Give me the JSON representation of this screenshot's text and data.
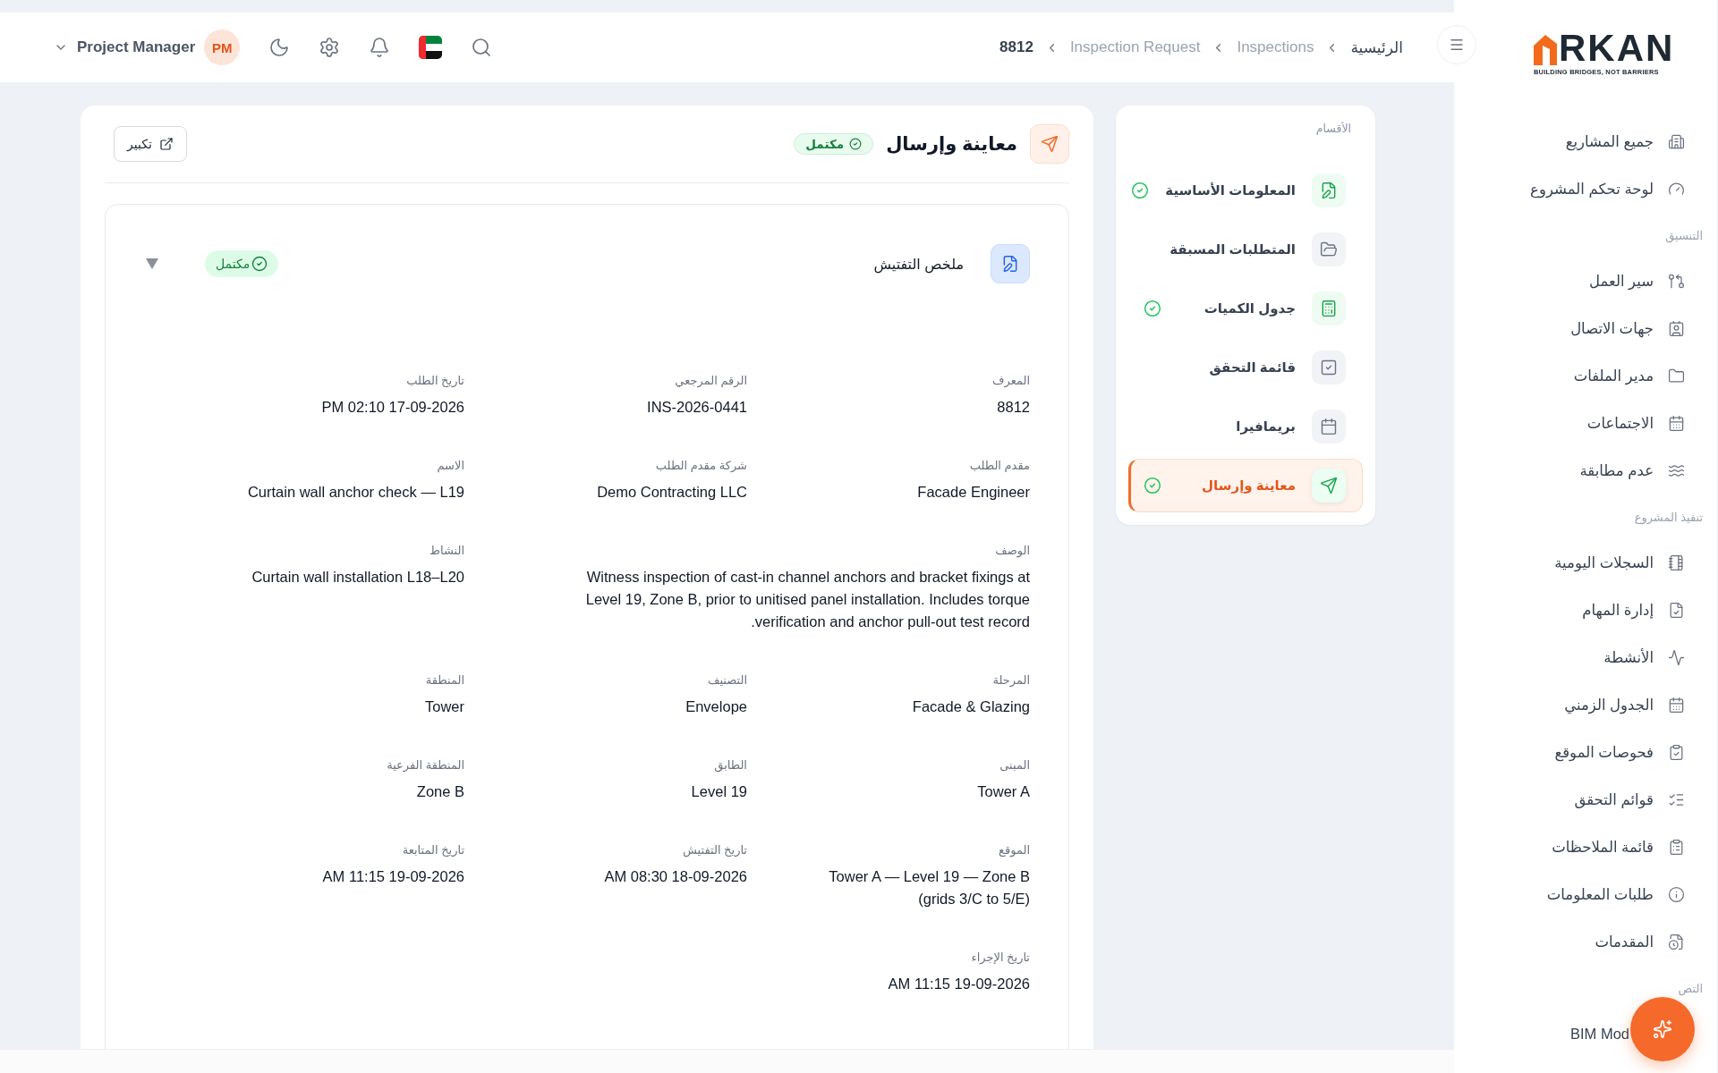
{
  "header": {
    "breadcrumb": [
      {
        "label": "الرئيسية",
        "kind": "home"
      },
      {
        "label": "Inspections",
        "kind": "link"
      },
      {
        "label": "Inspection Request",
        "kind": "link"
      },
      {
        "label": "8812",
        "kind": "current"
      }
    ],
    "user": {
      "name": "Project Manager",
      "initials": "PM"
    }
  },
  "sidebar": {
    "logo": {
      "wordmark": "RKAN",
      "tagline": "BUILDING BRIDGES, NOT BARRIERS"
    },
    "groups": [
      {
        "items": [
          "جميع المشاريع",
          "لوحة تحكم المشروع"
        ]
      },
      {
        "heading": "التنسيق",
        "items": [
          "سير العمل",
          "جهات الاتصال",
          "مدير الملفات",
          "الاجتماعات",
          "عدم مطابقة"
        ]
      },
      {
        "heading": "تنفيذ المشروع",
        "items": [
          "السجلات اليومية",
          "إدارة المهام",
          "الأنشطة",
          "الجدول الزمني",
          "فحوصات الموقع",
          "قوائم التحقق",
          "قائمة الملاحظات",
          "طلبات المعلومات",
          "المقدمات"
        ]
      },
      {
        "heading": "التص",
        "items": [
          "BIM Mod"
        ]
      }
    ]
  },
  "sections": {
    "title": "الأقسام",
    "items": [
      {
        "label": "المعلومات الأساسية",
        "completed": true,
        "selected": false
      },
      {
        "label": "المتطلبات المسبقة",
        "completed": false,
        "selected": false
      },
      {
        "label": "جدول الكميات",
        "completed": true,
        "selected": false
      },
      {
        "label": "قائمة التحقق",
        "completed": false,
        "selected": false
      },
      {
        "label": "بريمافيرا",
        "completed": false,
        "selected": false
      },
      {
        "label": "معاينة وإرسال",
        "completed": true,
        "selected": true
      }
    ]
  },
  "panel": {
    "title": "معاينة وإرسال",
    "status": "مكتمل",
    "expand_label": "تكبير",
    "summary": {
      "title": "ملخص التفتيش",
      "status": "مكتمل",
      "fields": [
        {
          "label": "المعرف",
          "value": "8812",
          "kind": "short"
        },
        {
          "label": "الرقم المرجعي",
          "value": "INS-2026-0441",
          "kind": "short"
        },
        {
          "label": "تاريخ الطلب",
          "value": "PM 02:10 17-09-2026",
          "kind": "short"
        },
        {
          "label": "مقدم الطلب",
          "value": "Facade Engineer",
          "kind": "short"
        },
        {
          "label": "شركة مقدم الطلب",
          "value": "Demo Contracting LLC",
          "kind": "short"
        },
        {
          "label": "الاسم",
          "value": "Curtain wall anchor check — L19",
          "kind": "short"
        },
        {
          "label": "الوصف",
          "value": "Witness inspection of cast-in channel anchors and bracket fixings at Level 19, Zone B, prior to unitised panel installation. Includes torque verification and anchor pull-out test record.",
          "kind": "paragraph"
        },
        {
          "label": "النشاط",
          "value": "Curtain wall installation L18–L20",
          "kind": "short"
        },
        {
          "label": "المرحلة",
          "value": "Facade & Glazing",
          "kind": "short"
        },
        {
          "label": "التصنيف",
          "value": "Envelope",
          "kind": "short"
        },
        {
          "label": "المنطقة",
          "value": "Tower",
          "kind": "short"
        },
        {
          "label": "المبنى",
          "value": "Tower A",
          "kind": "short"
        },
        {
          "label": "الطابق",
          "value": "Level 19",
          "kind": "short"
        },
        {
          "label": "المنطقة الفرعية",
          "value": "Zone B",
          "kind": "short"
        },
        {
          "label": "الموقع",
          "value": "Tower A — Level 19 — Zone B (grids 3/C to 5/E)",
          "kind": "short"
        },
        {
          "label": "تاريخ التفتيش",
          "value": "AM 08:30 18-09-2026",
          "kind": "short"
        },
        {
          "label": "تاريخ المتابعة",
          "value": "AM 11:15 19-09-2026",
          "kind": "short"
        },
        {
          "label": "تاريخ الإجراء",
          "value": "AM 11:15 19-09-2026",
          "kind": "short"
        }
      ]
    }
  }
}
